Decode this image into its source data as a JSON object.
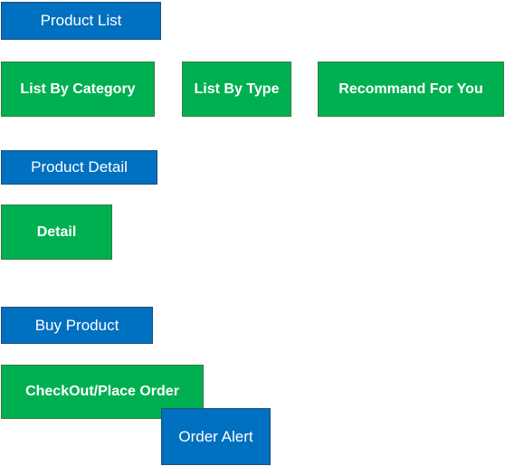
{
  "sections": {
    "product_list": {
      "header": "Product List",
      "items": [
        "List By Category",
        "List By Type",
        "Recommand For You"
      ]
    },
    "product_detail": {
      "header": "Product Detail",
      "items": [
        "Detail"
      ]
    },
    "buy_product": {
      "header": "Buy Product",
      "items": [
        "CheckOut/Place Order",
        "Order Alert"
      ]
    }
  },
  "colors": {
    "section_header": "#0070c0",
    "feature_box": "#00b050",
    "text": "#ffffff"
  }
}
